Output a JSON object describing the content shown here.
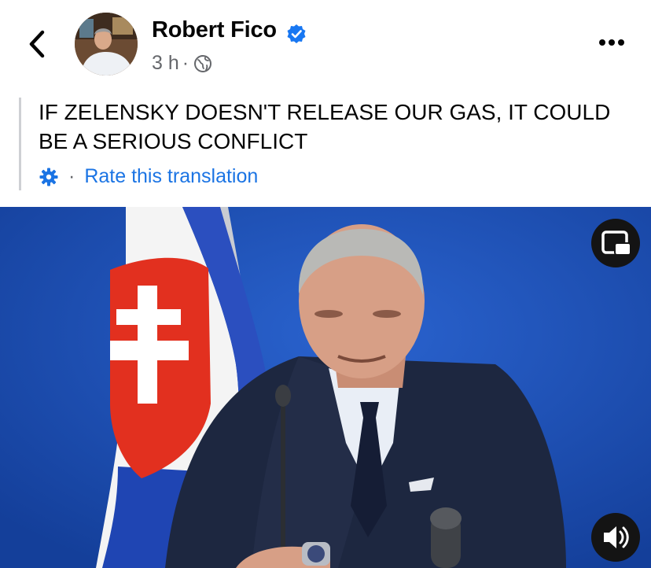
{
  "post": {
    "author": "Robert Fico",
    "time": "3 h",
    "separator": "·",
    "text": "IF ZELENSKY DOESN'T RELEASE OUR GAS, IT COULD BE A SERIOUS CONFLICT",
    "translation_separator": "·",
    "translation_link": "Rate this translation"
  },
  "icons": {
    "back": "chevron-left-icon",
    "verified": "verified-badge-icon",
    "audience": "globe-icon",
    "more": "more-horizontal-icon",
    "translation": "gear-icon",
    "pip": "picture-in-picture-icon",
    "volume": "volume-icon"
  },
  "colors": {
    "text": "#050505",
    "secondary": "#65676b",
    "link": "#1b74e4",
    "verified": "#1877f2",
    "video_background": "#1a4fb5"
  }
}
